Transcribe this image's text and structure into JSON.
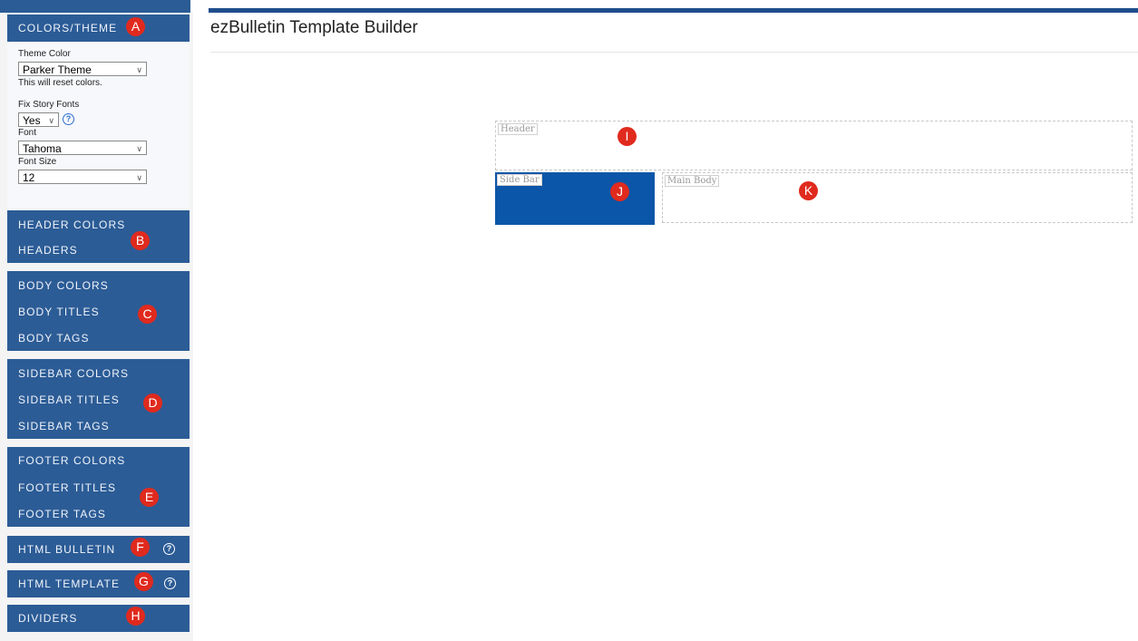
{
  "page": {
    "title": "ezBulletin Template Builder"
  },
  "colors": {
    "panel_bg": "#2c5c96",
    "badge": "#e02a1e",
    "sidebar_region": "#0b56a8"
  },
  "sidebar": {
    "colors_theme": {
      "heading": "COLORS/THEME",
      "badge": "A",
      "theme_color_label": "Theme Color",
      "theme_color_value": "Parker Theme",
      "reset_note": "This will reset colors.",
      "fix_story_fonts_label": "Fix Story Fonts",
      "fix_story_fonts_value": "Yes",
      "font_label": "Font",
      "font_value": "Tahoma",
      "font_size_label": "Font Size",
      "font_size_value": "12"
    },
    "header_group": {
      "items": [
        "HEADER COLORS",
        "HEADERS"
      ],
      "badge": "B"
    },
    "body_group": {
      "items": [
        "BODY COLORS",
        "BODY TITLES",
        "BODY TAGS"
      ],
      "badge": "C"
    },
    "sidebar_group": {
      "items": [
        "SIDEBAR COLORS",
        "SIDEBAR TITLES",
        "SIDEBAR TAGS"
      ],
      "badge": "D"
    },
    "footer_group": {
      "items": [
        "FOOTER COLORS",
        "FOOTER TITLES",
        "FOOTER TAGS"
      ],
      "badge": "E"
    },
    "html_bulletin": {
      "label": "HTML BULLETIN",
      "badge": "F",
      "help_icon": "question-circle-icon"
    },
    "html_template": {
      "label": "HTML TEMPLATE",
      "badge": "G",
      "help_icon": "question-circle-icon"
    },
    "dividers": {
      "label": "DIVIDERS",
      "badge": "H"
    }
  },
  "preview": {
    "header": {
      "label": "Header",
      "badge": "I"
    },
    "side_bar": {
      "label": "Side Bar",
      "badge": "J"
    },
    "main_body": {
      "label": "Main Body",
      "badge": "K"
    }
  }
}
